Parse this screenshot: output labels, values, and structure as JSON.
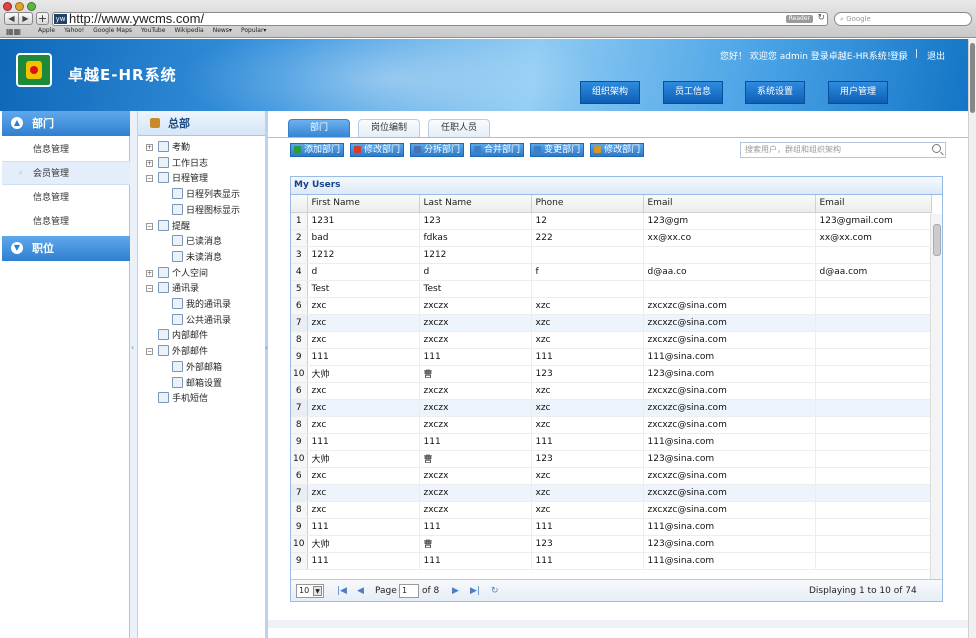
{
  "browser": {
    "url": "http://www.ywcms.com/",
    "favicon_text": "yw",
    "reader_label": "Reader",
    "search_placeholder": "Google",
    "bookmarks": [
      "Apple",
      "Yahoo!",
      "Google Maps",
      "YouTube",
      "Wikipedia",
      "News▾",
      "Popular▾"
    ]
  },
  "header": {
    "app_title": "卓越E-HR系统",
    "greeting": "您好！ 欢迎您 admin 登录卓越E-HR系统！ |",
    "login_link": "登录",
    "separator": "|",
    "logout_link": "退出",
    "nav_buttons": [
      "组织架构",
      "员工信息",
      "系统设置",
      "用户管理"
    ]
  },
  "left_panel": {
    "section1": "部门",
    "items": [
      "信息管理",
      "会员管理",
      "信息管理",
      "信息管理"
    ],
    "active_index": 1,
    "section2": "职位"
  },
  "tree": {
    "title": "总部",
    "nodes": [
      {
        "label": "考勤",
        "level": 0,
        "expand": "+"
      },
      {
        "label": "工作日志",
        "level": 0,
        "expand": "+"
      },
      {
        "label": "日程管理",
        "level": 0,
        "expand": "−"
      },
      {
        "label": "日程列表显示",
        "level": 1,
        "expand": ""
      },
      {
        "label": "日程图标显示",
        "level": 1,
        "expand": ""
      },
      {
        "label": "提醒",
        "level": 0,
        "expand": "−"
      },
      {
        "label": "已读消息",
        "level": 1,
        "expand": ""
      },
      {
        "label": "未读消息",
        "level": 1,
        "expand": ""
      },
      {
        "label": "个人空间",
        "level": 0,
        "expand": "+"
      },
      {
        "label": "通讯录",
        "level": 0,
        "expand": "−"
      },
      {
        "label": "我的通讯录",
        "level": 1,
        "expand": ""
      },
      {
        "label": "公共通讯录",
        "level": 1,
        "expand": ""
      },
      {
        "label": "内部邮件",
        "level": 0,
        "expand": ""
      },
      {
        "label": "外部邮件",
        "level": 0,
        "expand": "−"
      },
      {
        "label": "外部邮箱",
        "level": 1,
        "expand": ""
      },
      {
        "label": "邮箱设置",
        "level": 1,
        "expand": ""
      },
      {
        "label": "手机短信",
        "level": 0,
        "expand": ""
      }
    ]
  },
  "main": {
    "tabs": [
      "部门",
      "岗位编制",
      "任职人员"
    ],
    "active_tab": 0,
    "toolbar": [
      "添加部门",
      "修改部门",
      "分拆部门",
      "合并部门",
      "变更部门",
      "修改部门"
    ],
    "toolbar_icon_colors": [
      "#2e9b3a",
      "#d63a2a",
      "#4a6fb5",
      "#3a7fc4",
      "#3a7fc4",
      "#d19a2a"
    ],
    "search_placeholder": "搜索用户，群组和组织架构",
    "grid": {
      "title": "My Users",
      "columns": [
        "",
        "First Name",
        "Last Name",
        "Phone",
        "Email",
        "Email"
      ],
      "rows": [
        [
          "1",
          "1231",
          "123",
          "12",
          "123@gm",
          "123@gmail.com"
        ],
        [
          "2",
          "bad",
          "fdkas",
          "222",
          "xx@xx.co",
          "xx@xx.com"
        ],
        [
          "3",
          "1212",
          "1212",
          "",
          "",
          ""
        ],
        [
          "4",
          "d",
          "d",
          "f",
          "d@aa.co",
          "d@aa.com"
        ],
        [
          "5",
          "Test",
          "Test",
          "",
          "",
          ""
        ],
        [
          "6",
          "zxc",
          "zxczx",
          "xzc",
          "zxcxzc@sina.com",
          ""
        ],
        [
          "7",
          "zxc",
          "zxczx",
          "xzc",
          "zxcxzc@sina.com",
          ""
        ],
        [
          "8",
          "zxc",
          "zxczx",
          "xzc",
          "zxcxzc@sina.com",
          ""
        ],
        [
          "9",
          "111",
          "111",
          "111",
          "111@sina.com",
          ""
        ],
        [
          "10",
          "大帅",
          "曹",
          "123",
          "123@sina.com",
          ""
        ],
        [
          "6",
          "zxc",
          "zxczx",
          "xzc",
          "zxcxzc@sina.com",
          ""
        ],
        [
          "7",
          "zxc",
          "zxczx",
          "xzc",
          "zxcxzc@sina.com",
          ""
        ],
        [
          "8",
          "zxc",
          "zxczx",
          "xzc",
          "zxcxzc@sina.com",
          ""
        ],
        [
          "9",
          "111",
          "111",
          "111",
          "111@sina.com",
          ""
        ],
        [
          "10",
          "大帅",
          "曹",
          "123",
          "123@sina.com",
          ""
        ],
        [
          "6",
          "zxc",
          "zxczx",
          "xzc",
          "zxcxzc@sina.com",
          ""
        ],
        [
          "7",
          "zxc",
          "zxczx",
          "xzc",
          "zxcxzc@sina.com",
          ""
        ],
        [
          "8",
          "zxc",
          "zxczx",
          "xzc",
          "zxcxzc@sina.com",
          ""
        ],
        [
          "9",
          "111",
          "111",
          "111",
          "111@sina.com",
          ""
        ],
        [
          "10",
          "大帅",
          "曹",
          "123",
          "123@sina.com",
          ""
        ],
        [
          "9",
          "111",
          "111",
          "111",
          "111@sina.com",
          ""
        ]
      ],
      "highlighted_rows": [
        6,
        11,
        16
      ]
    },
    "pager": {
      "page_size": "10",
      "page_label": "Page",
      "current_page": "1",
      "of_label": "of 8",
      "display_text": "Displaying 1 to 10 of 74 items"
    }
  }
}
